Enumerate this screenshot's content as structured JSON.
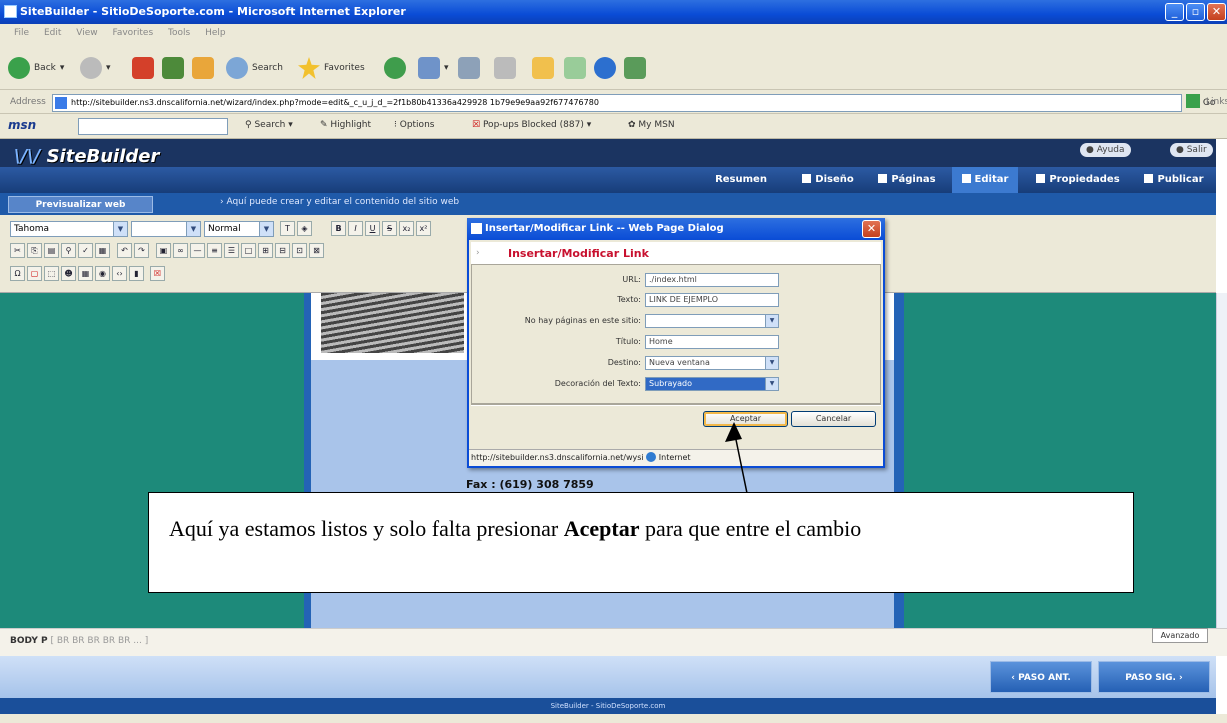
{
  "window": {
    "title": "SiteBuilder - SitioDeSoporte.com - Microsoft Internet Explorer"
  },
  "menu": [
    "File",
    "Edit",
    "View",
    "Favorites",
    "Tools",
    "Help"
  ],
  "toolbar": {
    "back": "Back",
    "search": "Search",
    "favorites": "Favorites"
  },
  "address": {
    "label": "Address",
    "url": "http://sitebuilder.ns3.dnscalifornia.net/wizard/index.php?mode=edit&_c_u_j_d_=2f1b80b41336a429928 1b79e9e9aa92f677476780",
    "go": "Go",
    "links": "Links"
  },
  "msn": {
    "logo": "msn",
    "search": "Search",
    "highlight": "Highlight",
    "options": "Options",
    "popups": "Pop-ups Blocked (887)",
    "mymsn": "My MSN"
  },
  "sitebuilder": {
    "logo_prefix": "\\/\\/",
    "logo": "SiteBuilder",
    "ayuda": "Ayuda",
    "salir": "Salir",
    "tabs": [
      "Resumen",
      "Diseño",
      "Páginas",
      "Editar",
      "Propiedades",
      "Publicar"
    ],
    "preview": "Previsualizar web",
    "hint": "Aquí puede crear y editar el contenido del sitio web"
  },
  "editor": {
    "font": "Tahoma",
    "style": "Normal",
    "fax": "Fax : (619) 308 7859",
    "path_bold": "BODY P",
    "path_rest": "[ BR BR BR BR BR ... ]",
    "advanced": "Avanzado"
  },
  "dialog": {
    "title": "Insertar/Modificar Link -- Web Page Dialog",
    "heading": "Insertar/Modificar Link",
    "fields": [
      {
        "label": "URL:",
        "value": "./index.html"
      },
      {
        "label": "Texto:",
        "value": "LINK DE EJEMPLO"
      },
      {
        "label": "No hay páginas en este sitio:",
        "value": ""
      },
      {
        "label": "Título:",
        "value": "Home"
      },
      {
        "label": "Destino:",
        "value": "Nueva ventana"
      },
      {
        "label": "Decoración del Texto:",
        "value": "Subrayado"
      }
    ],
    "accept": "Aceptar",
    "cancel": "Cancelar",
    "status_url": "http://sitebuilder.ns3.dnscalifornia.net/wysi",
    "status_zone": "Internet"
  },
  "footer": {
    "prev": "PASO ANT.",
    "next": "PASO SIG.",
    "brand": "SiteBuilder - SitioDeSoporte.com"
  },
  "callout": {
    "pre": "Aquí ya estamos listos y solo falta presionar ",
    "bold": "Aceptar",
    "post": " para que entre el cambio"
  }
}
